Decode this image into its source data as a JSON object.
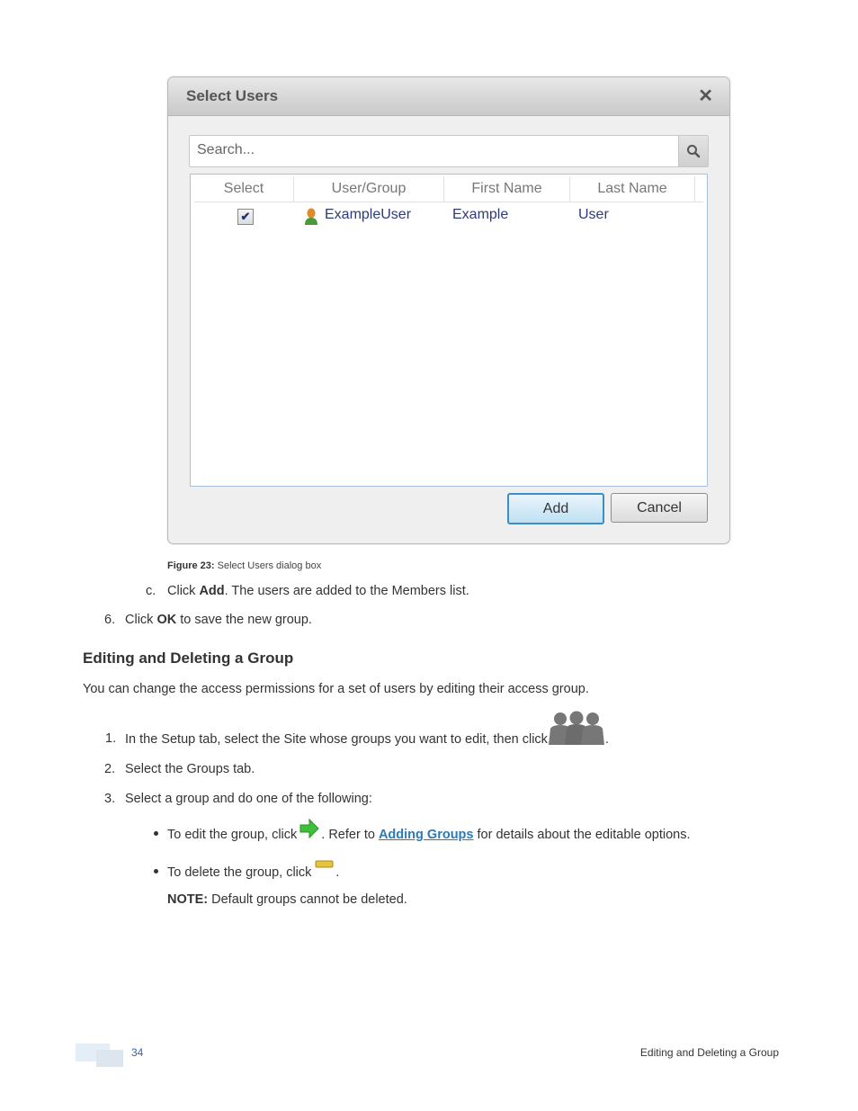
{
  "dialog": {
    "title": "Select Users",
    "close_icon": "close-icon",
    "search_placeholder": "Search...",
    "search_icon": "search-icon",
    "columns": [
      "Select",
      "User/Group",
      "First Name",
      "Last Name"
    ],
    "rows": [
      {
        "selected": true,
        "user_group": "ExampleUser",
        "first_name": "Example",
        "last_name": "User",
        "icon": "user-icon"
      }
    ],
    "add_label": "Add",
    "cancel_label": "Cancel"
  },
  "caption": {
    "label": "Figure 23:",
    "text": "Select Users dialog box"
  },
  "steps_before": [
    {
      "marker": "c.",
      "pre": "Click ",
      "bold": "Add",
      "post": ". The users are added to the Members list."
    },
    {
      "marker": "6.",
      "pre": "Click ",
      "bold": "OK",
      "post": " to save the new group."
    }
  ],
  "section": {
    "heading": "Editing and Deleting a Group",
    "intro": "You can change the access permissions for a set of users by editing their access group.",
    "steps": [
      {
        "marker": "1.",
        "text": "In the Setup tab, select the Site whose groups you want to edit, then click",
        "icon": "groups-icon",
        "after": "."
      },
      {
        "marker": "2.",
        "text": "Select the Groups tab."
      },
      {
        "marker": "3.",
        "text": "Select a group and do one of the following:"
      }
    ],
    "bullets": [
      {
        "pre": "To edit the group, click",
        "icon": "edit-arrow-icon",
        "mid": ". Refer to ",
        "link": "Adding Groups",
        "post": " for details about the editable options."
      },
      {
        "pre": "To delete the group, click",
        "icon": "delete-icon",
        "post": "."
      }
    ],
    "note_label": "NOTE:",
    "note_text": " Default groups cannot be deleted."
  },
  "footer": {
    "page_number": "34",
    "section_title": "Editing and Deleting a Group"
  },
  "colors": {
    "link": "#2a7ab8",
    "page_number": "#2a63c8",
    "dialog_accent": "#3d8fc3"
  }
}
